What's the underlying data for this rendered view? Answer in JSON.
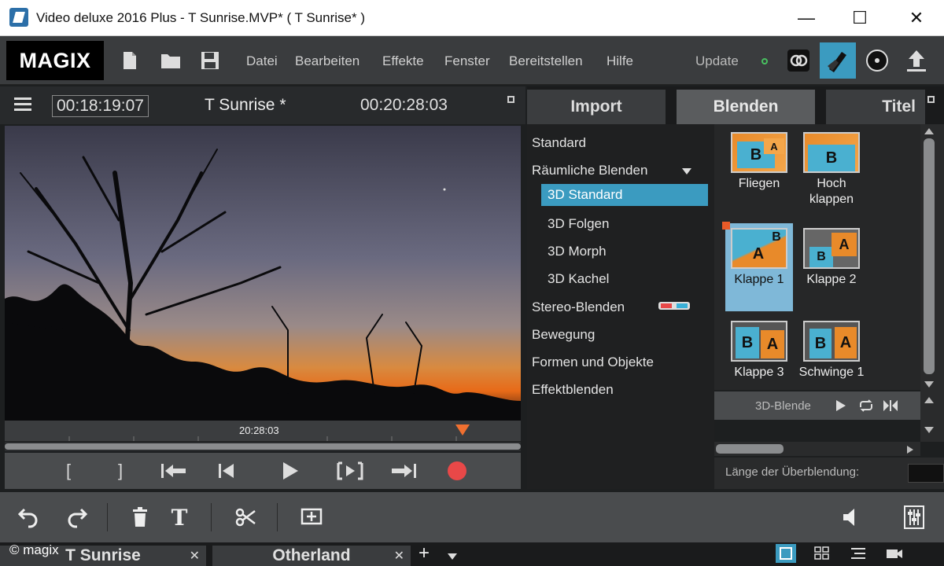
{
  "window": {
    "title": "Video deluxe 2016 Plus - T Sunrise.MVP* ( T Sunrise* )",
    "minimize": "—",
    "maximize": "☐",
    "close": "✕"
  },
  "menubar": {
    "logo": "MAGIX",
    "menus": [
      "Datei",
      "Bearbeiten",
      "Effekte",
      "Fenster",
      "Bereitstellen",
      "Hilfe"
    ],
    "update": "Update"
  },
  "preview": {
    "timecode_position": "00:18:19:07",
    "project_title": "T Sunrise *",
    "timecode_length": "00:20:28:03",
    "scrub_label": "20:28:03"
  },
  "transport": {
    "mark_in": "[",
    "mark_out": "]"
  },
  "panel": {
    "tabs": [
      "Import",
      "Blenden",
      "Titel"
    ],
    "active_tab": "Blenden",
    "categories": [
      {
        "label": "Standard"
      },
      {
        "label": "Räumliche Blenden"
      },
      {
        "label": "3D Standard"
      },
      {
        "label": "3D Folgen"
      },
      {
        "label": "3D Morph"
      },
      {
        "label": "3D Kachel"
      },
      {
        "label": "Stereo-Blenden"
      },
      {
        "label": "Bewegung"
      },
      {
        "label": "Formen und Objekte"
      },
      {
        "label": "Effektblenden"
      }
    ],
    "selected_category": "3D Standard",
    "transitions": [
      {
        "label": "Fliegen",
        "a": "A",
        "b": "B"
      },
      {
        "label": "Hoch klappen",
        "a": "",
        "b": "B"
      },
      {
        "label": "Klappe 1",
        "a": "A",
        "b": "B"
      },
      {
        "label": "Klappe 2",
        "a": "A",
        "b": "B"
      },
      {
        "label": "Klappe 3",
        "a": "A",
        "b": "B"
      },
      {
        "label": "Schwinge 1",
        "a": "A",
        "b": "B"
      }
    ],
    "selected_transition": "Klappe 1",
    "blend_bar_label": "3D-Blende",
    "length_label": "Länge der Überblendung:"
  },
  "project_tabs": [
    {
      "label": "T Sunrise"
    },
    {
      "label": "Otherland"
    }
  ],
  "add_tab": "+",
  "copyright": "© magix",
  "colors": {
    "accent": "#3b9bc0",
    "record": "#e84848",
    "playhead": "#f07030"
  }
}
